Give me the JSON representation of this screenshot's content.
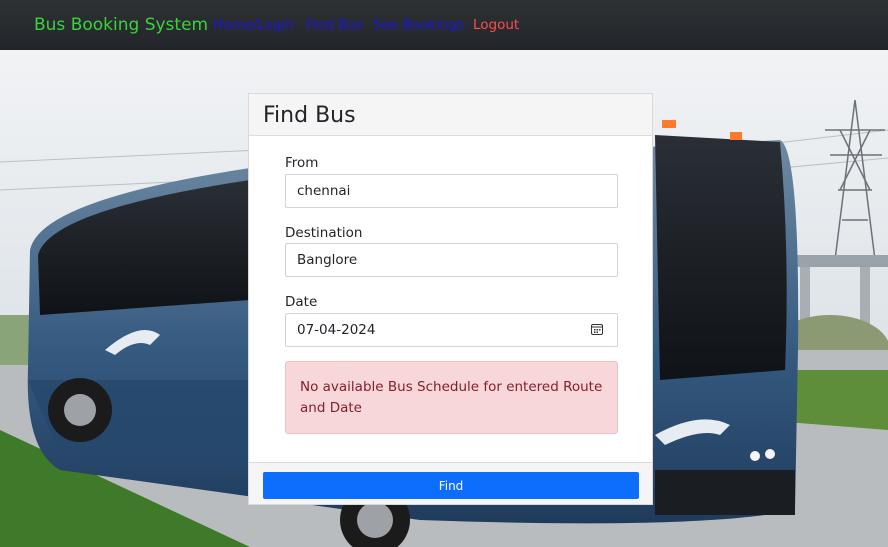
{
  "navbar": {
    "brand": "Bus Booking System",
    "links": [
      {
        "label": "Home/Login"
      },
      {
        "label": "Find Bus"
      },
      {
        "label": "See Bookings"
      },
      {
        "label": "Logout"
      }
    ],
    "brand_color": "#39d439",
    "link_color": "#1c17d6",
    "logout_color": "#ff4d4d"
  },
  "card": {
    "title": "Find Bus",
    "from": {
      "label": "From",
      "value": "chennai"
    },
    "destination": {
      "label": "Destination",
      "value": "Banglore"
    },
    "date": {
      "label": "Date",
      "value": "07-04-2024",
      "icon": "calendar-icon"
    },
    "alert": {
      "text": "No available Bus Schedule for entered Route and Date",
      "bg_color": "#f8d7da",
      "text_color": "#842029"
    },
    "button": {
      "label": "Find",
      "color": "#0d6efd"
    }
  }
}
